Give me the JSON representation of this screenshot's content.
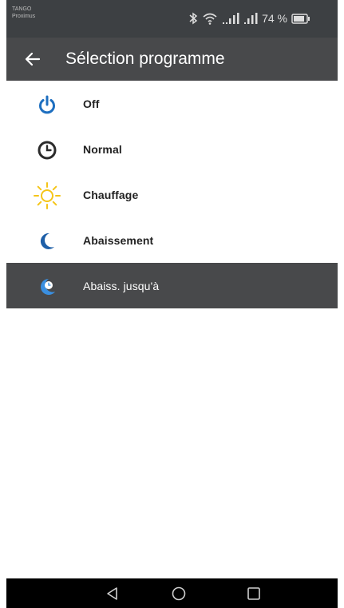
{
  "status": {
    "carrier_line1": "TANGO",
    "carrier_line2": "Proximus",
    "battery": "74 %"
  },
  "appbar": {
    "title": "Sélection programme"
  },
  "items": [
    {
      "label": "Off",
      "icon": "power-icon"
    },
    {
      "label": "Normal",
      "icon": "clock-icon"
    },
    {
      "label": "Chauffage",
      "icon": "sun-icon"
    },
    {
      "label": "Abaissement",
      "icon": "moon-icon"
    },
    {
      "label": "Abaiss. jusqu'à",
      "icon": "moon-clock-icon",
      "selected": true
    }
  ],
  "colors": {
    "statusbar": "#3d4043",
    "appbar": "#48494b",
    "accent_blue": "#1e6fc0",
    "sun_yellow": "#f5c518"
  },
  "navbar": {
    "buttons": [
      "back-triangle-icon",
      "home-circle-icon",
      "recents-square-icon"
    ]
  }
}
